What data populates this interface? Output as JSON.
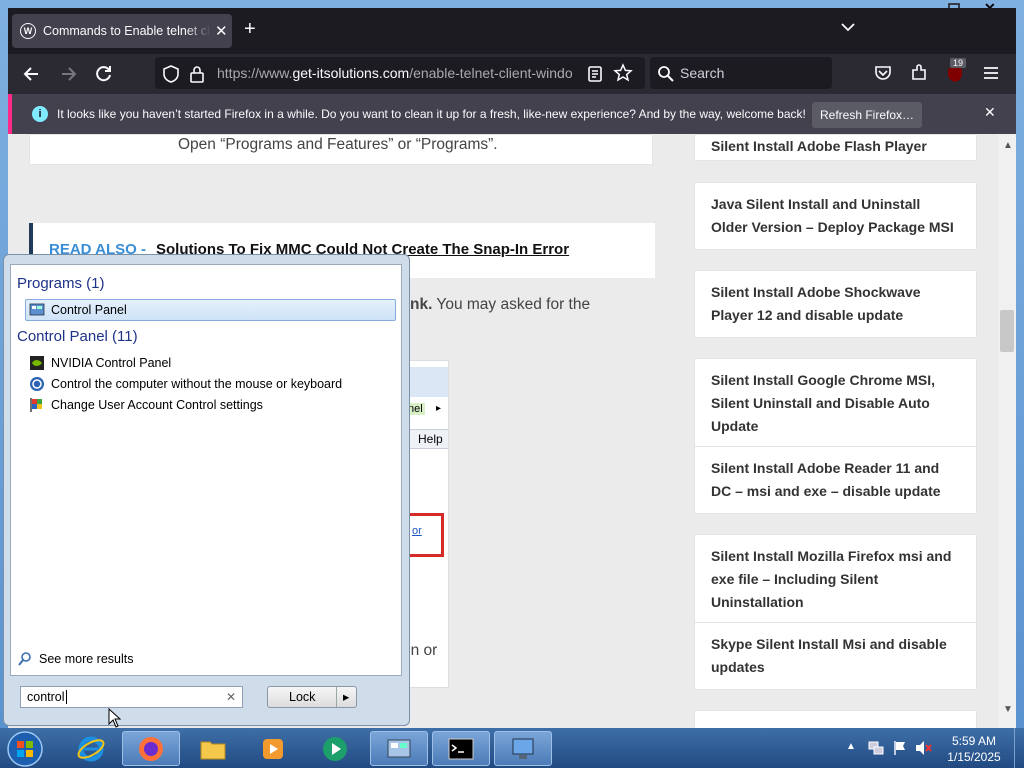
{
  "browser": {
    "tab_title": "Commands to Enable telnet client",
    "tab_close": "✕",
    "new_tab": "+",
    "url_prefix": "https://www.",
    "url_domain": "get-itsolutions.com",
    "url_path": "/enable-telnet-client-windo",
    "search_placeholder": "Search",
    "badge_count": "19",
    "notification": "It looks like you haven’t started Firefox in a while. Do you want to clean it up for a fresh, like-new experience? And by the way, welcome back!",
    "refresh_label": "Refresh Firefox…",
    "notif_close": "✕"
  },
  "article": {
    "open_text": "Open “Programs and Features” or “Programs”.",
    "read_also_label": "READ ALSO -",
    "read_also_link": "Solutions To Fix MMC Could Not Create The Snap-In Error",
    "frag_bold": "nk.",
    "frag_text": " You may asked for the",
    "frag_nel": "nel",
    "frag_help": "Help",
    "frag_or": "or",
    "frag_onor": "on or"
  },
  "sidebar_links": [
    "Silent Install Adobe Flash Player",
    "Java Silent Install and Uninstall Older Version – Deploy Package MSI",
    "Silent Install Adobe Shockwave Player 12 and disable update",
    "Silent Install Google Chrome MSI, Silent Uninstall and Disable Auto Update",
    "Silent Install Adobe Reader 11 and DC – msi and exe – disable update",
    "Silent Install Mozilla Firefox msi and exe file – Including Silent Uninstallation",
    "Skype Silent Install Msi and disable updates"
  ],
  "start_menu": {
    "programs_header": "Programs (1)",
    "program_item": "Control Panel",
    "cp_header": "Control Panel (11)",
    "cp_items": [
      "NVIDIA Control Panel",
      "Control the computer without the mouse or keyboard",
      "Change User Account Control settings"
    ],
    "see_more": "See more results",
    "search_value": "control",
    "lock_label": "Lock",
    "lock_arrow": "▸"
  },
  "taskbar": {
    "time": "5:59 AM",
    "date": "1/15/2025"
  },
  "colors": {
    "accent_pink": "#ff2a8a",
    "link_blue": "#3a8ed6",
    "taskbar_blue": "#214a82"
  }
}
